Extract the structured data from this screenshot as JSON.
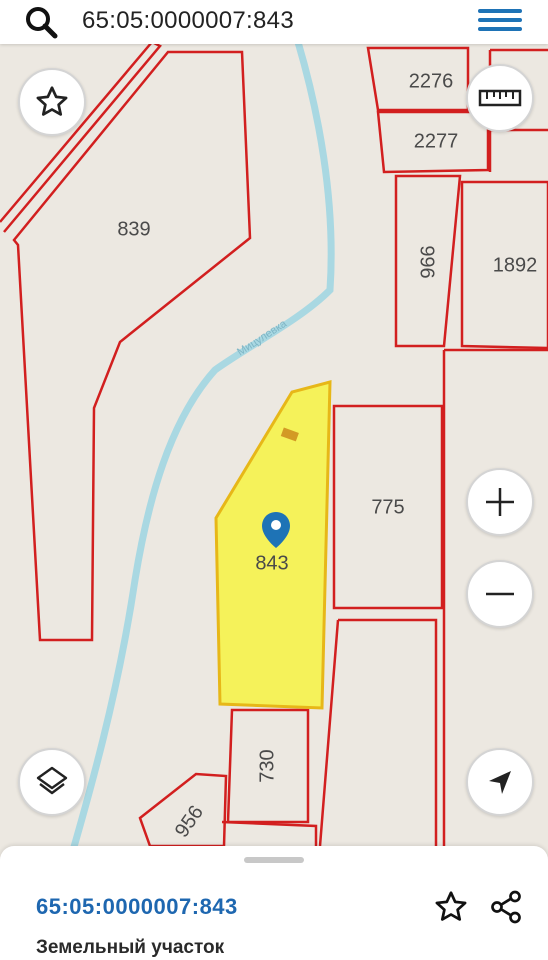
{
  "search": {
    "query": "65:05:0000007:843"
  },
  "map": {
    "river_label": "Мицулевка",
    "parcels": [
      {
        "id": "839",
        "label": "839",
        "highlighted": false
      },
      {
        "id": "2276",
        "label": "2276",
        "highlighted": false
      },
      {
        "id": "2277",
        "label": "2277",
        "highlighted": false
      },
      {
        "id": "996",
        "label": "996",
        "highlighted": false
      },
      {
        "id": "1892",
        "label": "1892",
        "highlighted": false
      },
      {
        "id": "775",
        "label": "775",
        "highlighted": false
      },
      {
        "id": "843",
        "label": "843",
        "highlighted": true
      },
      {
        "id": "730",
        "label": "730",
        "highlighted": false
      },
      {
        "id": "956",
        "label": "956",
        "highlighted": false
      }
    ],
    "colors": {
      "background": "#ece8e1",
      "parcel_border": "#d21f1f",
      "highlight_fill": "#f5f25a",
      "highlight_border": "#e7b718",
      "river": "#a9d8e2",
      "marker": "#1e73b6"
    }
  },
  "controls": {
    "favorite_icon": "star-icon",
    "ruler_icon": "ruler-icon",
    "zoom_in_icon": "plus-icon",
    "zoom_out_icon": "minus-icon",
    "layers_icon": "layers-icon",
    "locate_icon": "navigation-arrow-icon"
  },
  "sheet": {
    "title": "65:05:0000007:843",
    "subtitle": "Земельный участок"
  }
}
